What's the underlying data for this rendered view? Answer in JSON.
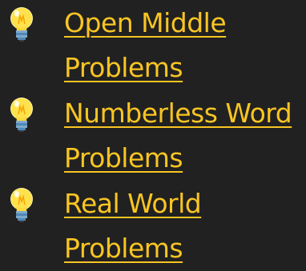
{
  "links": [
    {
      "label": "Open Middle Problems"
    },
    {
      "label": "Numberless Word Problems"
    },
    {
      "label": "Real World Problems"
    }
  ],
  "icons": {
    "bullet": "lightbulb-emoji-icon"
  },
  "colors": {
    "background": "#212121",
    "link": "#f9c523"
  }
}
